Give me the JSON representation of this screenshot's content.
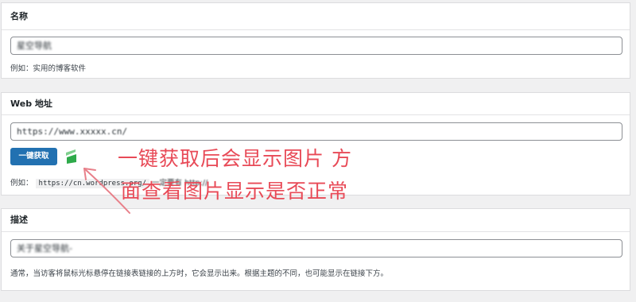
{
  "name_panel": {
    "heading": "名称",
    "value_visible": "",
    "value_blurred": "星空导航",
    "help": "例如：实用的博客软件"
  },
  "web_panel": {
    "heading": "Web 地址",
    "value": "https://www.xxxxx.cn/",
    "fetch_button": "一键获取",
    "help_label": "例如：",
    "help_code": "https://cn.wordpress.org/",
    "help_tail": "一定要有 http://"
  },
  "desc_panel": {
    "heading": "描述",
    "value_blurred": "关于星空导航-",
    "help": "通常，当访客将鼠标光标悬停在链接表链接的上方时，它会显示出来。根据主题的不同，也可能显示在链接下方。"
  },
  "annotation": {
    "line1": "一键获取后会显示图片 方",
    "line2": "面查看图片显示是否正常"
  },
  "colors": {
    "accent": "#2271b1",
    "annotation": "#e84a57",
    "favicon_green": "#2eaa4a"
  },
  "icons": {
    "favicon": "site-favicon-icon"
  }
}
